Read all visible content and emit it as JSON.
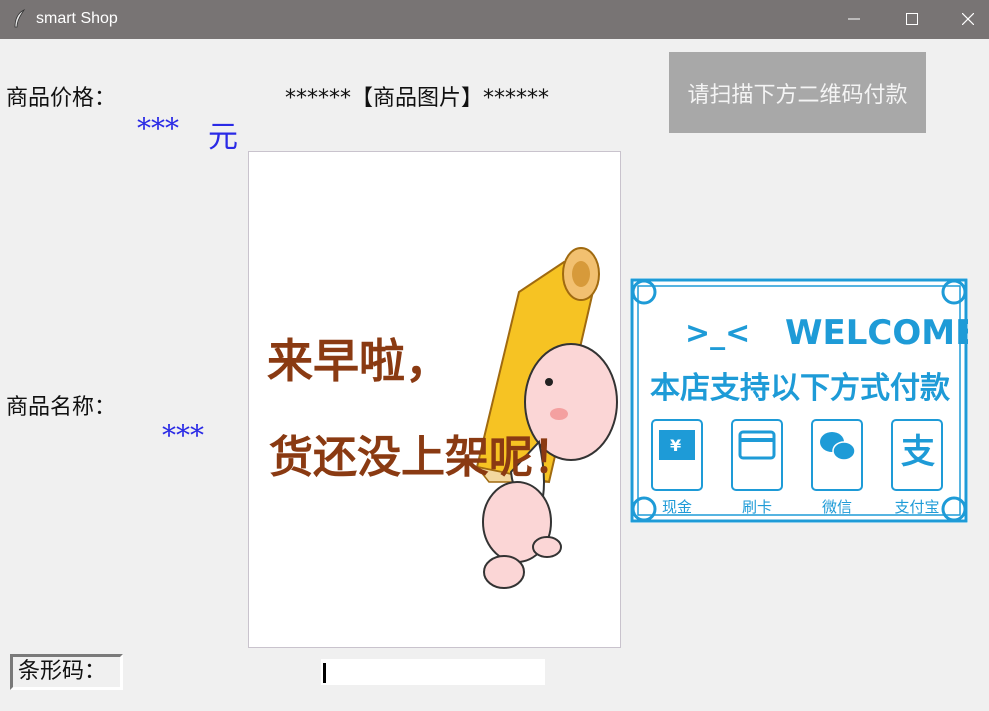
{
  "window": {
    "title": "smart Shop"
  },
  "labels": {
    "price": "商品价格：",
    "image_heading": "******【商品图片】******",
    "name": "商品名称：",
    "barcode": "条形码："
  },
  "values": {
    "price_value": "***",
    "price_unit": "元",
    "name_value": "***",
    "barcode_value": ""
  },
  "scan_button": {
    "label": "请扫描下方二维码付款"
  },
  "product_image": {
    "line1": "来早啦，",
    "line2": "货还没上架呢！"
  },
  "payment_banner": {
    "emoticon": ">_<",
    "welcome": "WELCOME",
    "headline": "本店支持以下方式付款",
    "methods": [
      {
        "label": "现金",
        "icon": "cash-icon"
      },
      {
        "label": "刷卡",
        "icon": "card-icon"
      },
      {
        "label": "微信",
        "icon": "wechat-icon"
      },
      {
        "label": "支付宝",
        "icon": "alipay-icon"
      }
    ]
  },
  "colors": {
    "titlebar": "#787474",
    "value_blue": "#2a2ae6",
    "banner_blue": "#1e9bd7",
    "image_text_brown": "#8a3a12"
  }
}
